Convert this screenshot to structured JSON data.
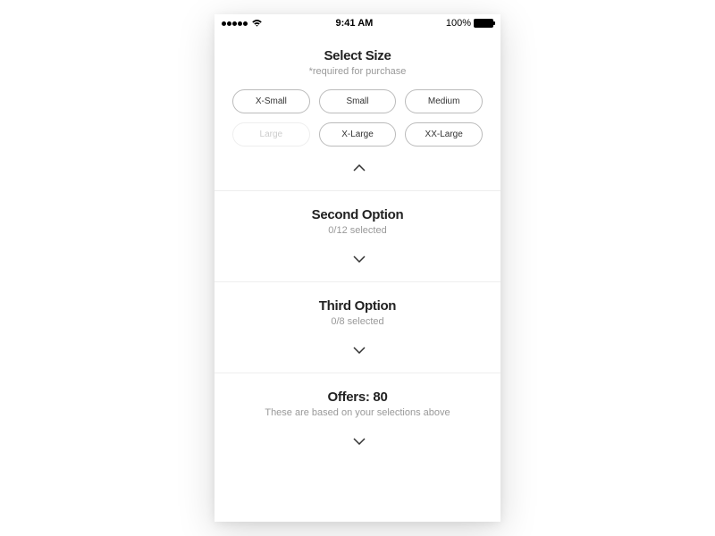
{
  "status": {
    "time": "9:41 AM",
    "battery": "100%"
  },
  "size_section": {
    "title": "Select Size",
    "subtitle": "*required for purchase",
    "sizes": {
      "s0": "X-Small",
      "s1": "Small",
      "s2": "Medium",
      "s3": "Large",
      "s4": "X-Large",
      "s5": "XX-Large"
    }
  },
  "second_option": {
    "title": "Second Option",
    "subtitle": "0/12 selected"
  },
  "third_option": {
    "title": "Third Option",
    "subtitle": "0/8 selected"
  },
  "offers": {
    "title": "Offers: 80",
    "subtitle": "These are based on your selections above"
  }
}
